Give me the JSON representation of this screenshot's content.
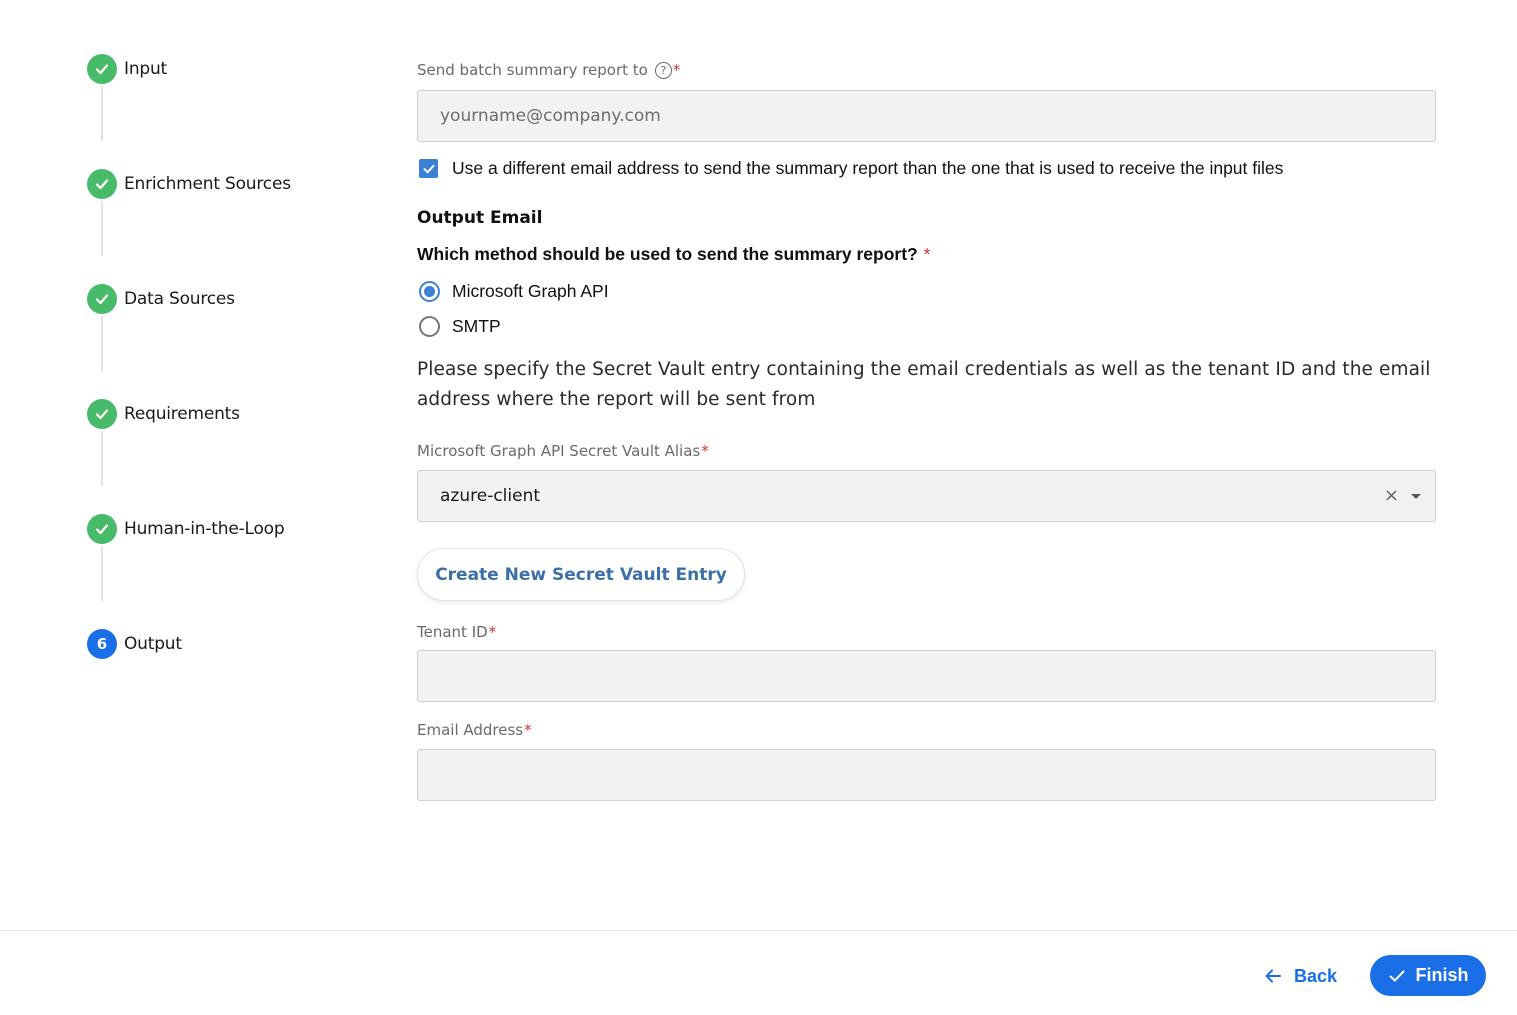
{
  "stepper": {
    "steps": [
      {
        "label": "Input",
        "status": "done"
      },
      {
        "label": "Enrichment Sources",
        "status": "done"
      },
      {
        "label": "Data Sources",
        "status": "done"
      },
      {
        "label": "Requirements",
        "status": "done"
      },
      {
        "label": "Human-in-the-Loop",
        "status": "done"
      },
      {
        "label": "Output",
        "status": "active",
        "number": "6"
      }
    ]
  },
  "form": {
    "batch_report": {
      "label": "Send batch summary report to",
      "required_mark": "*",
      "help_icon": "question-circle-icon",
      "placeholder": "yourname@company.com",
      "value": ""
    },
    "different_email_checkbox": {
      "label": "Use a different email address to send the summary report than the one that is used to receive the input files",
      "checked": true
    },
    "output_email_title": "Output Email",
    "method_question": {
      "label": "Which method should be used to send the summary report?",
      "required_mark": "*",
      "options": [
        {
          "label": "Microsoft Graph API",
          "selected": true
        },
        {
          "label": "SMTP",
          "selected": false
        }
      ]
    },
    "description": "Please specify the Secret Vault entry containing the email credentials as well as the tenant ID and the email address where the report will be sent from",
    "vault_alias": {
      "label": "Microsoft Graph API Secret Vault Alias",
      "required_mark": "*",
      "value": "azure-client"
    },
    "create_vault_button": "Create New Secret Vault Entry",
    "tenant_id": {
      "label": "Tenant ID",
      "required_mark": "*",
      "value": ""
    },
    "email_address": {
      "label": "Email Address",
      "required_mark": "*",
      "value": ""
    }
  },
  "footer": {
    "back_label": "Back",
    "finish_label": "Finish"
  },
  "colors": {
    "step_done": "#48bb6a",
    "step_active": "#1a6fe6",
    "primary": "#1a6fe6",
    "checkbox": "#3b82d6",
    "required": "#d0323a"
  }
}
